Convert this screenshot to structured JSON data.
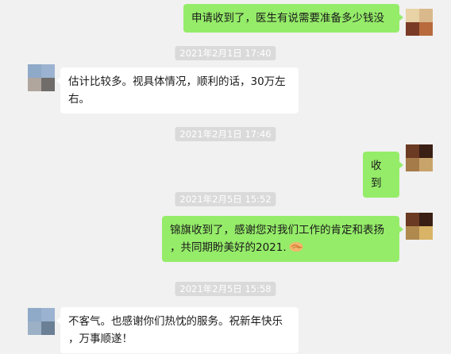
{
  "messages": [
    {
      "type": "out",
      "text": "申请收到了，医生有说需要准备多少钱没"
    },
    {
      "type": "time",
      "text": "2021年2月1日 17:40"
    },
    {
      "type": "in",
      "line1": "估计比较多。视具体情况，顺利的话，30万左",
      "line2": "右。"
    },
    {
      "type": "time",
      "text": "2021年2月1日 17:46"
    },
    {
      "type": "out",
      "text": "收到"
    },
    {
      "type": "time",
      "text": "2021年2月5日 15:52"
    },
    {
      "type": "out",
      "line1": "锦旗收到了，感谢您对我们工作的肯定和表扬",
      "line2": "，共同期盼美好的2021."
    },
    {
      "type": "time",
      "text": "2021年2月5日 15:58"
    },
    {
      "type": "in",
      "line1": "不客气。也感谢你们热忱的服务。祝新年快乐",
      "line2": "，万事顺遂！"
    }
  ],
  "icons": {
    "handshake": "handshake-emoji"
  },
  "colors": {
    "outgoing": "#95ec69",
    "incoming": "#ffffff",
    "background": "#f1f1f1"
  }
}
